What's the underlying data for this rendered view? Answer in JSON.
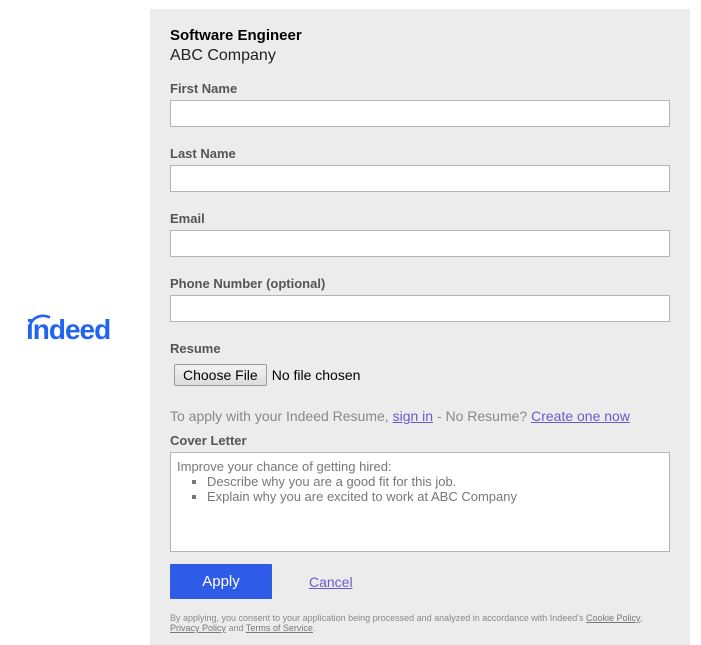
{
  "brand": {
    "logo_text": "indeed",
    "logo_color": "#2164f3"
  },
  "job": {
    "title": "Software Engineer",
    "company": "ABC Company"
  },
  "form": {
    "first_name_label": "First Name",
    "last_name_label": "Last Name",
    "email_label": "Email",
    "phone_label": "Phone Number (optional)",
    "resume_label": "Resume",
    "choose_file_label": "Choose File",
    "file_status": "No file chosen",
    "resume_note": {
      "prefix": "To apply with your Indeed Resume, ",
      "sign_in": "sign in",
      "middle": " - No Resume? ",
      "create": "Create one now"
    },
    "cover_letter_label": "Cover Letter",
    "cover_letter_placeholder": {
      "intro": "Improve your chance of getting hired:",
      "bullets": [
        "Describe why you are a good fit for this job.",
        "Explain why you are excited to work at ABC Company"
      ]
    },
    "apply_label": "Apply",
    "cancel_label": "Cancel",
    "consent": {
      "prefix": "By applying, you consent to your application being processed and analyzed in accordance with Indeed's ",
      "cookie_policy": "Cookie Policy",
      "sep1": ",",
      "privacy_policy": "Privacy Policy",
      "and": " and ",
      "terms": "Terms of Service",
      "suffix": "."
    }
  },
  "colors": {
    "panel_bg": "#ececec",
    "apply_bg": "#2e5be8",
    "link": "#6a5acd"
  }
}
